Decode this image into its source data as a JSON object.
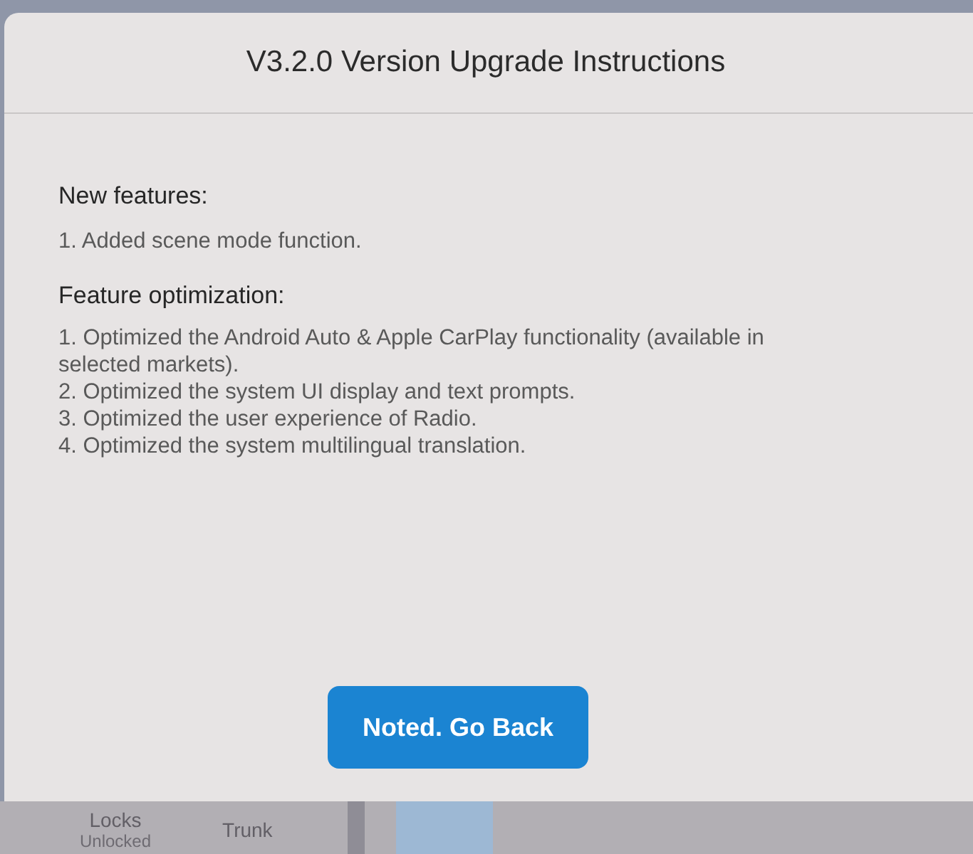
{
  "dialog": {
    "title": "V3.2.0 Version Upgrade Instructions",
    "sections": [
      {
        "heading": "New features:",
        "items": [
          "1. Added scene mode function."
        ]
      },
      {
        "heading": "Feature optimization:",
        "items": [
          "1. Optimized the Android Auto & Apple CarPlay functionality (available in selected markets).",
          "2. Optimized the system UI display and text prompts.",
          "3. Optimized the user experience of Radio.",
          "4. Optimized the system multilingual translation."
        ]
      }
    ],
    "button": "Noted. Go Back"
  },
  "status_bar": {
    "items": [
      {
        "label": "Locks",
        "value": "Unlocked"
      },
      {
        "label": "Trunk"
      }
    ]
  }
}
